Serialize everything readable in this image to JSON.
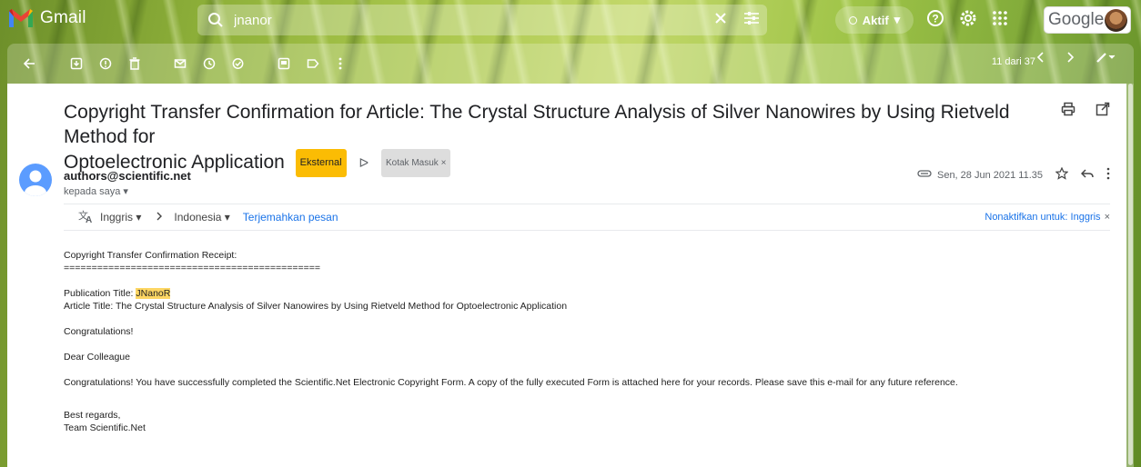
{
  "app": {
    "name": "Gmail"
  },
  "search": {
    "value": "jnanor"
  },
  "status": {
    "label": "Aktif"
  },
  "brand": {
    "google": "Google"
  },
  "pager": {
    "text": "11 dari 37"
  },
  "subject": {
    "line1": "Copyright Transfer Confirmation for Article: The Crystal Structure Analysis of Silver Nanowires by Using Rietveld Method for",
    "line2": "Optoelectronic Application",
    "badge_external": "Eksternal",
    "label_inbox": "Kotak Masuk ×"
  },
  "sender": {
    "email": "authors@scientific.net",
    "to": "kepada saya ▾",
    "date": "Sen, 28 Jun 2021 11.35"
  },
  "translate": {
    "from": "Inggris",
    "to": "Indonesia",
    "action": "Terjemahkan pesan",
    "disable": "Nonaktifkan untuk: Inggris"
  },
  "body": {
    "l1": "Copyright Transfer Confirmation Receipt:",
    "l2": "==============================================",
    "pub_label": "Publication Title: ",
    "pub_value": "JNanoR",
    "article": "Article Title: The Crystal Structure Analysis of Silver Nanowires by Using Rietveld Method for Optoelectronic Application",
    "congrats": "Congratulations!",
    "dear": "Dear Colleague",
    "para": "Congratulations! You have successfully completed the Scientific.Net Electronic Copyright Form. A copy of the fully executed Form is attached here for your records. Please save this e-mail for any future reference.",
    "regards": "Best regards,",
    "team": "Team Scientific.Net"
  },
  "colors": {
    "accent_blue": "#1a73e8",
    "external_badge": "#fbbc04",
    "highlight": "#fdd663"
  }
}
